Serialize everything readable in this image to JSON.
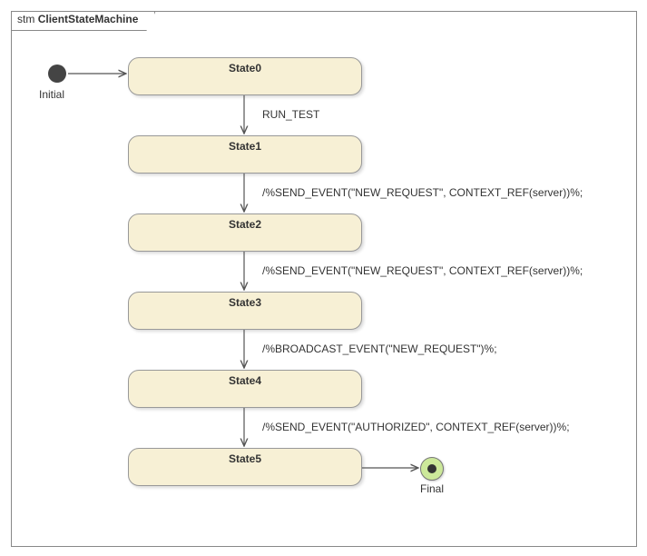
{
  "frame": {
    "kind": "stm",
    "title": "ClientStateMachine"
  },
  "nodes": {
    "initial": {
      "label": "Initial"
    },
    "final": {
      "label": "Final"
    },
    "states": [
      {
        "id": "state0",
        "name": "State0"
      },
      {
        "id": "state1",
        "name": "State1"
      },
      {
        "id": "state2",
        "name": "State2"
      },
      {
        "id": "state3",
        "name": "State3"
      },
      {
        "id": "state4",
        "name": "State4"
      },
      {
        "id": "state5",
        "name": "State5"
      }
    ]
  },
  "transitions": [
    {
      "id": "t_init_s0",
      "from": "initial",
      "to": "state0",
      "label": ""
    },
    {
      "id": "t_s0_s1",
      "from": "state0",
      "to": "state1",
      "label": "RUN_TEST"
    },
    {
      "id": "t_s1_s2",
      "from": "state1",
      "to": "state2",
      "label": "/%SEND_EVENT(\"NEW_REQUEST\", CONTEXT_REF(server))%;"
    },
    {
      "id": "t_s2_s3",
      "from": "state2",
      "to": "state3",
      "label": "/%SEND_EVENT(\"NEW_REQUEST\", CONTEXT_REF(server))%;"
    },
    {
      "id": "t_s3_s4",
      "from": "state3",
      "to": "state4",
      "label": "/%BROADCAST_EVENT(\"NEW_REQUEST\")%;"
    },
    {
      "id": "t_s4_s5",
      "from": "state4",
      "to": "state5",
      "label": "/%SEND_EVENT(\"AUTHORIZED\", CONTEXT_REF(server))%;"
    },
    {
      "id": "t_s5_final",
      "from": "state5",
      "to": "final",
      "label": ""
    }
  ]
}
